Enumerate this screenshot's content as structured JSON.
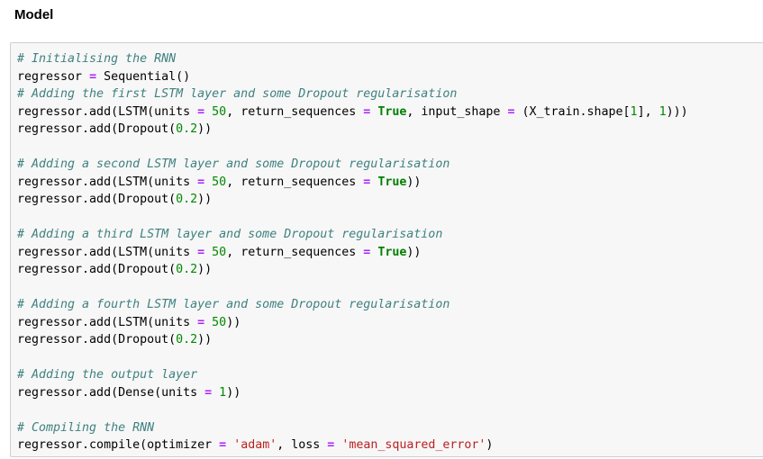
{
  "heading": "Model",
  "colors": {
    "comment": "#408080",
    "operator": "#aa22ff",
    "number": "#008800",
    "keyword": "#008000",
    "string": "#ba2121",
    "cell_background": "#f7f7f7",
    "cell_border": "#cfcfcf"
  },
  "code_lines": [
    [
      [
        "c",
        "# Initialising the RNN"
      ]
    ],
    [
      [
        "n",
        "regressor "
      ],
      [
        "o",
        "="
      ],
      [
        "n",
        " Sequential()"
      ]
    ],
    [
      [
        "c",
        "# Adding the first LSTM layer and some Dropout regularisation"
      ]
    ],
    [
      [
        "n",
        "regressor.add(LSTM(units "
      ],
      [
        "o",
        "="
      ],
      [
        "n",
        " "
      ],
      [
        "m",
        "50"
      ],
      [
        "n",
        ", return_sequences "
      ],
      [
        "o",
        "="
      ],
      [
        "n",
        " "
      ],
      [
        "k",
        "True"
      ],
      [
        "n",
        ", input_shape "
      ],
      [
        "o",
        "="
      ],
      [
        "n",
        " (X_train.shape["
      ],
      [
        "m",
        "1"
      ],
      [
        "n",
        "], "
      ],
      [
        "m",
        "1"
      ],
      [
        "n",
        ")))"
      ]
    ],
    [
      [
        "n",
        "regressor.add(Dropout("
      ],
      [
        "m",
        "0.2"
      ],
      [
        "n",
        "))"
      ]
    ],
    [],
    [
      [
        "c",
        "# Adding a second LSTM layer and some Dropout regularisation"
      ]
    ],
    [
      [
        "n",
        "regressor.add(LSTM(units "
      ],
      [
        "o",
        "="
      ],
      [
        "n",
        " "
      ],
      [
        "m",
        "50"
      ],
      [
        "n",
        ", return_sequences "
      ],
      [
        "o",
        "="
      ],
      [
        "n",
        " "
      ],
      [
        "k",
        "True"
      ],
      [
        "n",
        "))"
      ]
    ],
    [
      [
        "n",
        "regressor.add(Dropout("
      ],
      [
        "m",
        "0.2"
      ],
      [
        "n",
        "))"
      ]
    ],
    [],
    [
      [
        "c",
        "# Adding a third LSTM layer and some Dropout regularisation"
      ]
    ],
    [
      [
        "n",
        "regressor.add(LSTM(units "
      ],
      [
        "o",
        "="
      ],
      [
        "n",
        " "
      ],
      [
        "m",
        "50"
      ],
      [
        "n",
        ", return_sequences "
      ],
      [
        "o",
        "="
      ],
      [
        "n",
        " "
      ],
      [
        "k",
        "True"
      ],
      [
        "n",
        "))"
      ]
    ],
    [
      [
        "n",
        "regressor.add(Dropout("
      ],
      [
        "m",
        "0.2"
      ],
      [
        "n",
        "))"
      ]
    ],
    [],
    [
      [
        "c",
        "# Adding a fourth LSTM layer and some Dropout regularisation"
      ]
    ],
    [
      [
        "n",
        "regressor.add(LSTM(units "
      ],
      [
        "o",
        "="
      ],
      [
        "n",
        " "
      ],
      [
        "m",
        "50"
      ],
      [
        "n",
        "))"
      ]
    ],
    [
      [
        "n",
        "regressor.add(Dropout("
      ],
      [
        "m",
        "0.2"
      ],
      [
        "n",
        "))"
      ]
    ],
    [],
    [
      [
        "c",
        "# Adding the output layer"
      ]
    ],
    [
      [
        "n",
        "regressor.add(Dense(units "
      ],
      [
        "o",
        "="
      ],
      [
        "n",
        " "
      ],
      [
        "m",
        "1"
      ],
      [
        "n",
        "))"
      ]
    ],
    [],
    [
      [
        "c",
        "# Compiling the RNN"
      ]
    ],
    [
      [
        "n",
        "regressor.compile(optimizer "
      ],
      [
        "o",
        "="
      ],
      [
        "n",
        " "
      ],
      [
        "s",
        "'adam'"
      ],
      [
        "n",
        ", loss "
      ],
      [
        "o",
        "="
      ],
      [
        "n",
        " "
      ],
      [
        "s",
        "'mean_squared_error'"
      ],
      [
        "n",
        ")"
      ]
    ]
  ]
}
